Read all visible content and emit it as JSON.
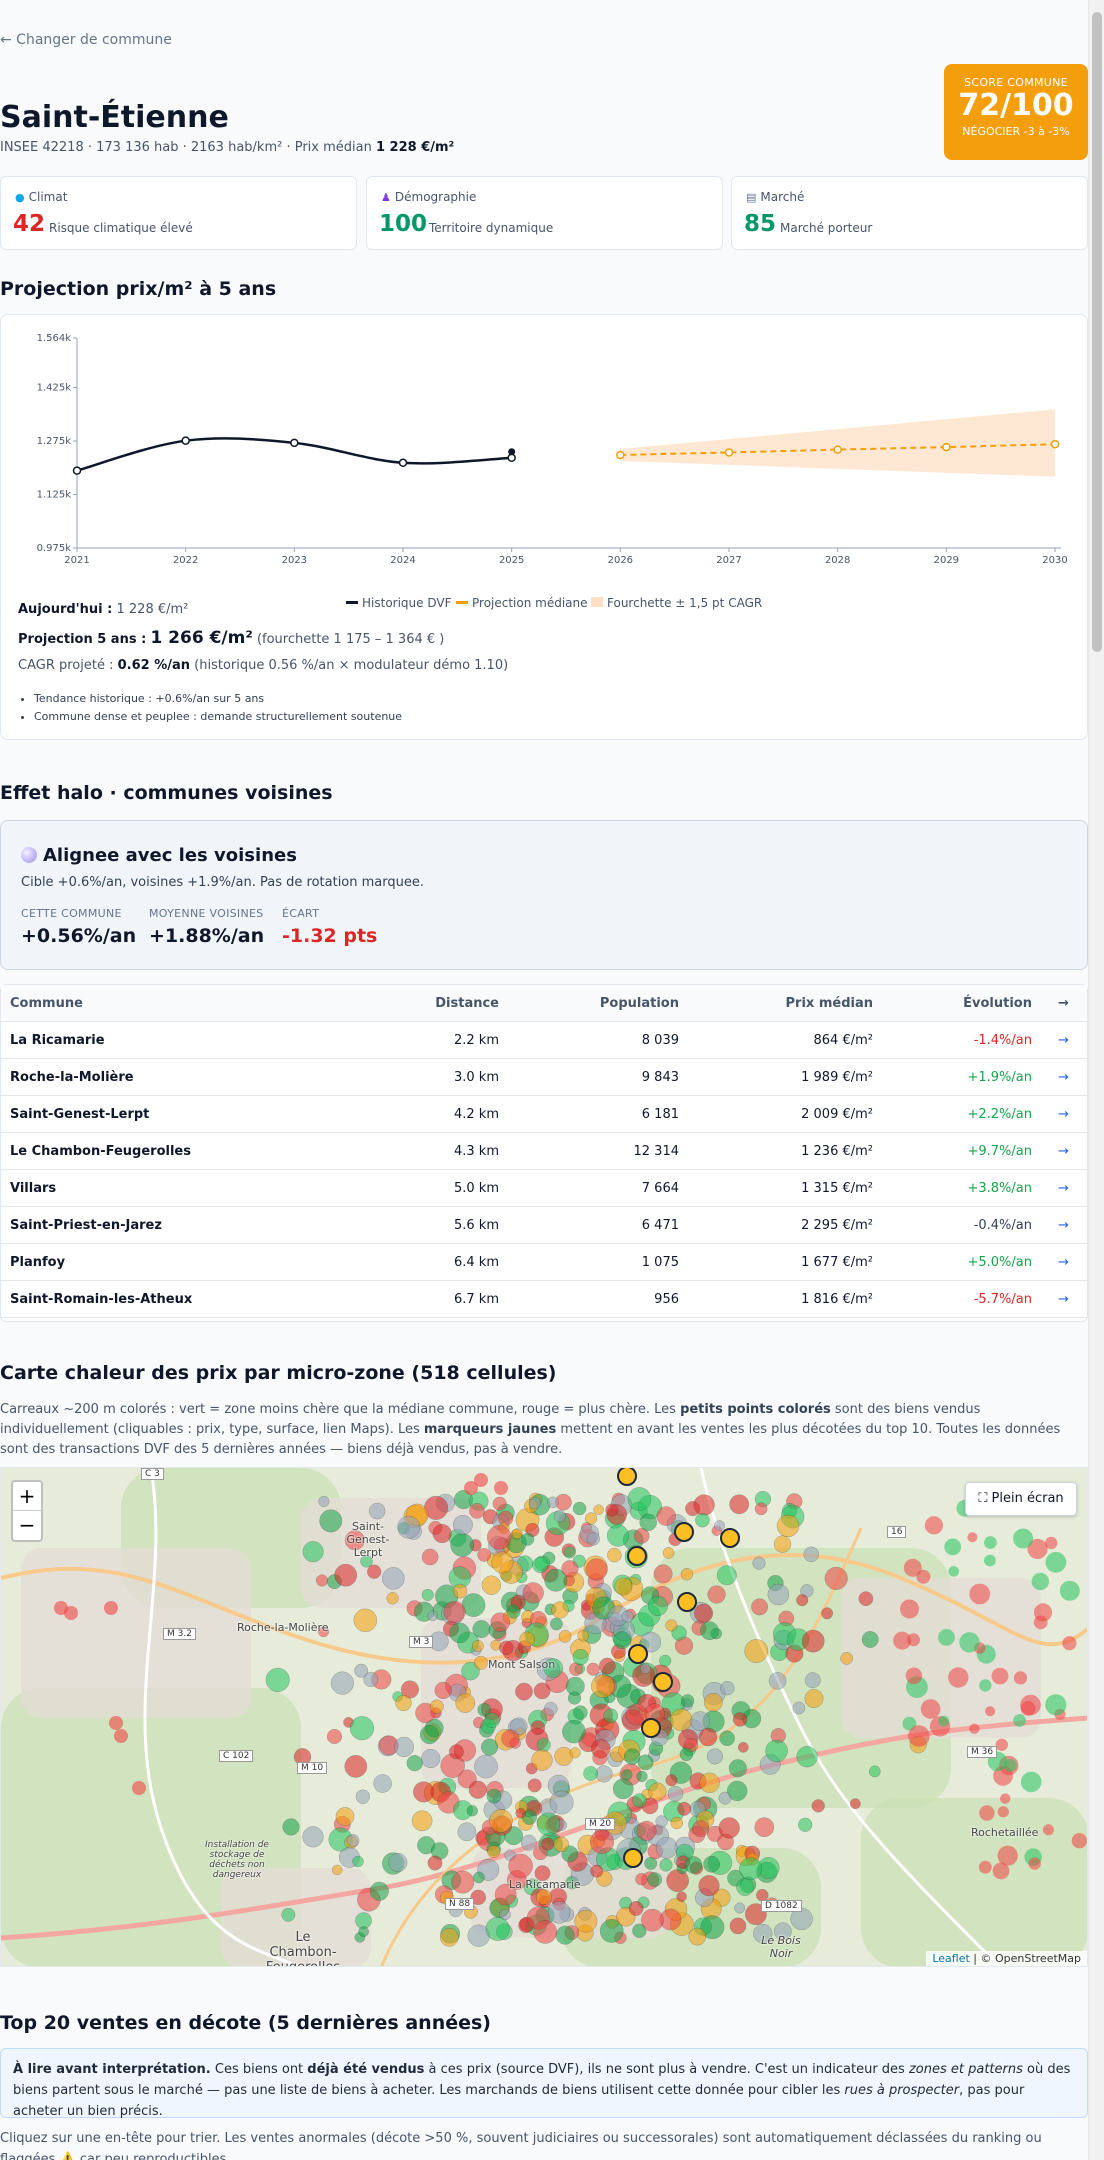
{
  "nav": {
    "back_label": "← Changer de commune"
  },
  "header": {
    "title": "Saint-Étienne",
    "meta_prefix": "INSEE 42218 · 173 136 hab · 2163 hab/km² · Prix médian ",
    "meta_price": "1 228 €/m²"
  },
  "score": {
    "label": "SCORE COMMUNE",
    "value": "72/100",
    "advice": "NÉGOCIER -3 à -3%",
    "color": "#f59e0b"
  },
  "cards": [
    {
      "icon": "globe-icon",
      "title": "Climat",
      "value": "42",
      "text": "Risque climatique élevé",
      "color": "#dc2626"
    },
    {
      "icon": "people-icon",
      "title": "Démographie",
      "value": "100",
      "text": "Territoire dynamique",
      "color": "#059669"
    },
    {
      "icon": "chart-icon",
      "title": "Marché",
      "value": "85",
      "text": "Marché porteur",
      "color": "#059669"
    }
  ],
  "projection": {
    "heading": "Projection prix/m² à 5 ans",
    "legend": [
      "Historique DVF",
      "Projection médiane",
      "Fourchette ± 1,5 pt CAGR"
    ],
    "today_label": "Aujourd'hui :",
    "today_value": "1 228 €/m²",
    "proj_label": "Projection 5 ans :",
    "proj_value": "1 266 €/m²",
    "proj_range": "(fourchette 1 175 – 1 364 € )",
    "cagr_label": "CAGR projeté :",
    "cagr_value": "0.62 %/an",
    "cagr_detail": "(historique 0.56 %/an × modulateur démo 1.10)",
    "bullets": [
      "Tendance historique : +0.6%/an sur 5 ans",
      "Commune dense et peuplee : demande structurellement soutenue"
    ]
  },
  "chart_data": {
    "type": "line",
    "title": "",
    "xlabel": "",
    "ylabel": "",
    "x": [
      2021,
      2022,
      2023,
      2024,
      2025,
      2026,
      2027,
      2028,
      2029,
      2030
    ],
    "y_ticks": [
      "0.975k",
      "1.125k",
      "1.275k",
      "1.425k",
      "1.564k"
    ],
    "ylim": [
      975,
      1564
    ],
    "series": [
      {
        "name": "Historique DVF",
        "color": "#0f172a",
        "x": [
          2021,
          2022,
          2023,
          2024,
          2025
        ],
        "values": [
          1192,
          1276,
          1270,
          1214,
          1228
        ]
      },
      {
        "name": "Projection médiane",
        "color": "#f59e0b",
        "x": [
          2026,
          2027,
          2028,
          2029,
          2030
        ],
        "values": [
          1236,
          1243,
          1251,
          1258,
          1266
        ]
      }
    ],
    "band": {
      "name": "Fourchette ± 1,5 pt CAGR",
      "color": "#fde0c5",
      "x": [
        2026,
        2030
      ],
      "lower": [
        1219,
        1175
      ],
      "upper": [
        1253,
        1364
      ]
    },
    "last_point": {
      "x": 2025,
      "value": 1245
    },
    "grid": false,
    "legend_position": "bottom"
  },
  "halo": {
    "heading": "Effet halo · communes voisines",
    "title": "Alignee avec les voisines",
    "subtitle": "Cible +0.6%/an, voisines +1.9%/an. Pas de rotation marquee.",
    "stats": [
      {
        "label": "CETTE COMMUNE",
        "value": "+0.56%/an",
        "color": "#0f172a"
      },
      {
        "label": "MOYENNE VOISINES",
        "value": "+1.88%/an",
        "color": "#0f172a"
      },
      {
        "label": "ÉCART",
        "value": "-1.32 pts",
        "color": "#dc2626"
      }
    ]
  },
  "neighbors": {
    "headers": [
      "Commune",
      "Distance",
      "Population",
      "Prix médian",
      "Évolution",
      "→"
    ],
    "rows": [
      {
        "name": "La Ricamarie",
        "distance": "2.2 km",
        "population": "8 039",
        "price": "864 €/m²",
        "evolution": "-1.4%/an",
        "color": "#dc2626",
        "arrow": "→"
      },
      {
        "name": "Roche-la-Molière",
        "distance": "3.0 km",
        "population": "9 843",
        "price": "1 989 €/m²",
        "evolution": "+1.9%/an",
        "color": "#16a34a",
        "arrow": "→"
      },
      {
        "name": "Saint-Genest-Lerpt",
        "distance": "4.2 km",
        "population": "6 181",
        "price": "2 009 €/m²",
        "evolution": "+2.2%/an",
        "color": "#16a34a",
        "arrow": "→"
      },
      {
        "name": "Le Chambon-Feugerolles",
        "distance": "4.3 km",
        "population": "12 314",
        "price": "1 236 €/m²",
        "evolution": "+9.7%/an",
        "color": "#16a34a",
        "arrow": "→"
      },
      {
        "name": "Villars",
        "distance": "5.0 km",
        "population": "7 664",
        "price": "1 315 €/m²",
        "evolution": "+3.8%/an",
        "color": "#16a34a",
        "arrow": "→"
      },
      {
        "name": "Saint-Priest-en-Jarez",
        "distance": "5.6 km",
        "population": "6 471",
        "price": "2 295 €/m²",
        "evolution": "-0.4%/an",
        "color": "#334155",
        "arrow": "→"
      },
      {
        "name": "Planfoy",
        "distance": "6.4 km",
        "population": "1 075",
        "price": "1 677 €/m²",
        "evolution": "+5.0%/an",
        "color": "#16a34a",
        "arrow": "→"
      },
      {
        "name": "Saint-Romain-les-Atheux",
        "distance": "6.7 km",
        "population": "956",
        "price": "1 816 €/m²",
        "evolution": "-5.7%/an",
        "color": "#dc2626",
        "arrow": "→"
      }
    ]
  },
  "heatmap": {
    "heading": "Carte chaleur des prix par micro-zone (518 cellules)",
    "desc_1": "Carreaux ~200 m colorés : vert = zone moins chère que la médiane commune, rouge = plus chère. Les ",
    "desc_b1": "petits points colorés",
    "desc_2": " sont des biens vendus individuellement (cliquables : prix, type, surface, lien Maps). Les ",
    "desc_b2": "marqueurs jaunes",
    "desc_3": " mettent en avant les ventes les plus décotées du top 10. Toutes les données sont des transactions DVF des 5 dernières années — biens déjà vendus, pas à vendre.",
    "zoom_in": "+",
    "zoom_out": "−",
    "fullscreen": "⛶ Plein écran",
    "attribution_leaflet": "Leaflet",
    "attribution_osm": "| © OpenStreetMap",
    "labels": [
      "Saint-Genest-Lerpt",
      "Roche-la-Molière",
      "Mont Salson",
      "La Ricamarie",
      "Le Chambon-Feugerolles",
      "Rochetaillée",
      "Le Bois Noir",
      "Installation de stockage de déchets non dangereux"
    ],
    "roads": [
      "C 3",
      "M 3.2",
      "M 3",
      "C 102",
      "M 10",
      "M 20",
      "N 88",
      "D 1082",
      "M 36",
      "16"
    ]
  },
  "top20": {
    "heading": "Top 20 ventes en décote (5 dernières années)",
    "notice_b1": "À lire avant interprétation.",
    "notice_1": " Ces biens ont ",
    "notice_b2": "déjà été vendus",
    "notice_2": " à ces prix (source DVF), ils ne sont plus à vendre. C'est un indicateur des ",
    "notice_i1": "zones et patterns",
    "notice_3": " où des biens partent sous le marché — pas une liste de biens à acheter. Les marchands de biens utilisent cette donnée pour cibler les ",
    "notice_i2": "rues à prospecter",
    "notice_4": ", pas pour acheter un bien précis.",
    "footnote": "Cliquez sur une en-tête pour trier. Les ventes anormales (décote >50 %, souvent judiciaires ou successorales) sont automatiquement déclassées du ranking ou flaggées ⚠️ car peu reproductibles."
  }
}
